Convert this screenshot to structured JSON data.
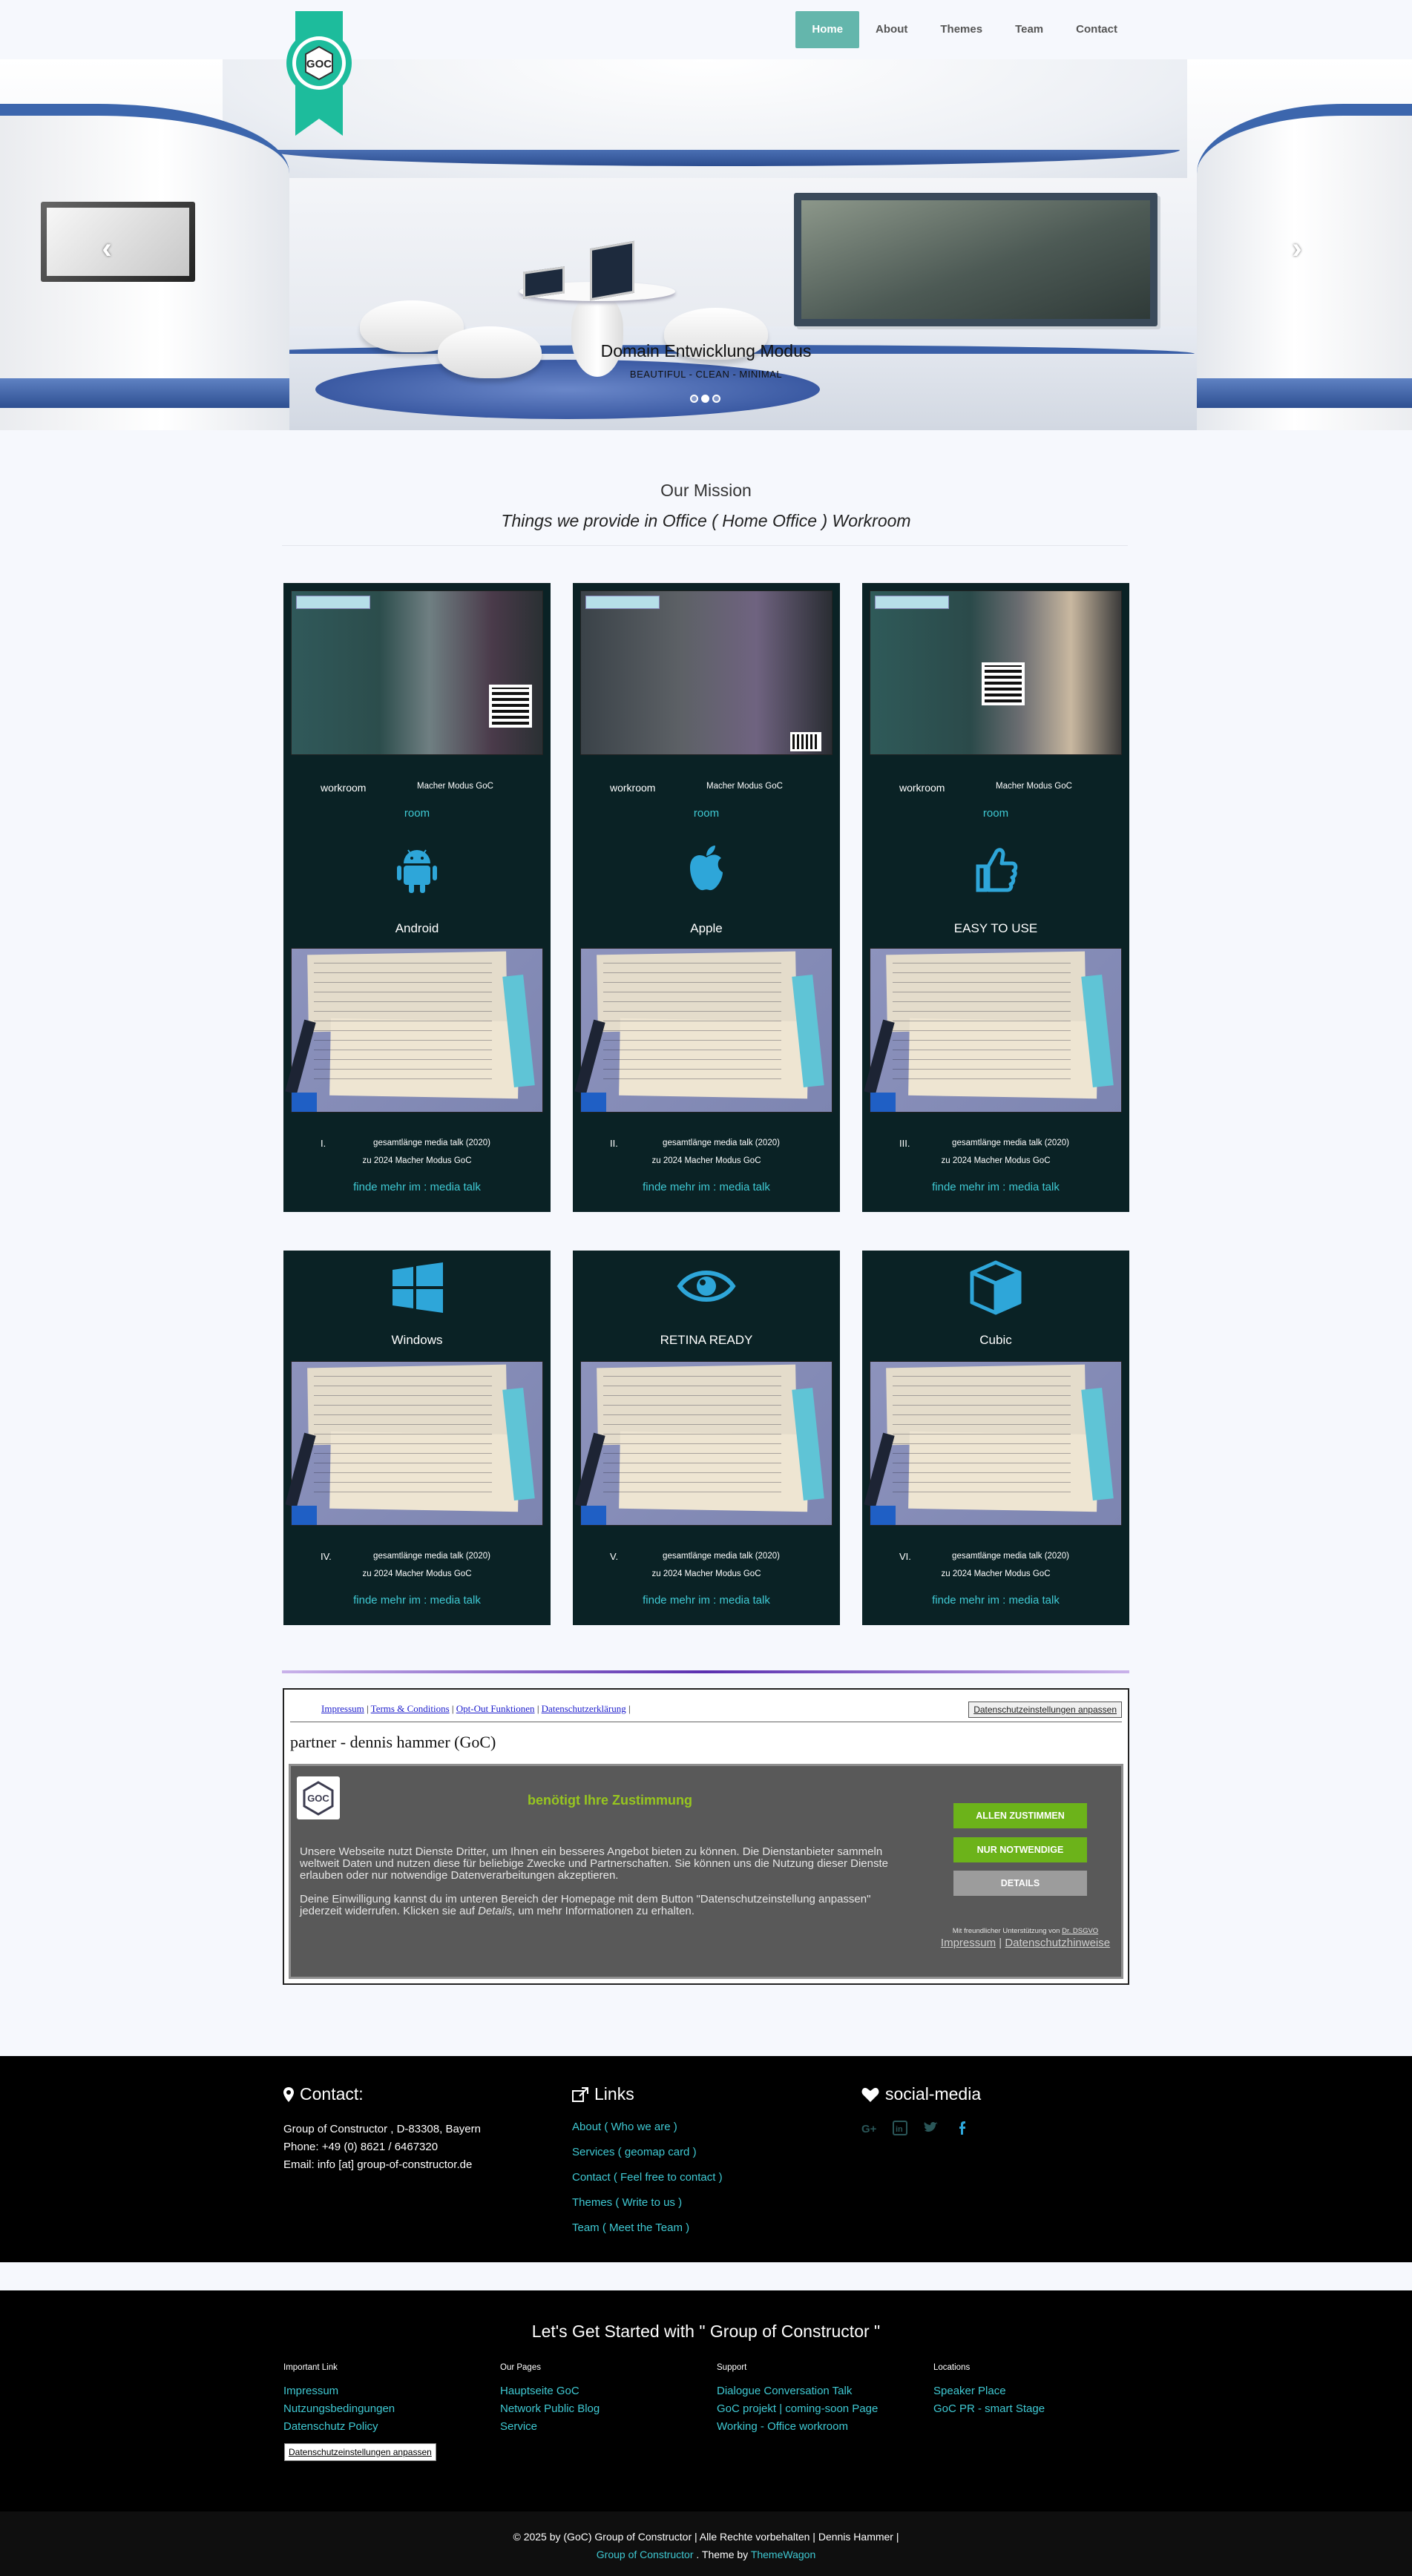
{
  "nav": {
    "items": [
      {
        "label": "Home"
      },
      {
        "label": "About"
      },
      {
        "label": "Themes"
      },
      {
        "label": "Team"
      },
      {
        "label": "Contact"
      }
    ],
    "logo_text": "GOC"
  },
  "hero": {
    "title": "Domain Entwicklung Modus",
    "subtitle": "BEAUTIFUL - CLEAN - MINIMAL",
    "prev_icon": "chevron-left-icon",
    "next_icon": "chevron-right-icon"
  },
  "mission": {
    "title": "Our Mission",
    "subtitle": "Things we provide in Office ( Home Office ) Workroom"
  },
  "cards_row1": [
    {
      "room_left": "workroom",
      "room_right": "Macher Modus GoC",
      "room_link": "room",
      "icon": "android-icon",
      "title": "Android",
      "roman": "I.",
      "meta1": "gesamtlänge media talk (2020)",
      "meta2": "zu 2024 Macher Modus GoC",
      "link": "finde mehr im : media talk"
    },
    {
      "room_left": "workroom",
      "room_right": "Macher Modus GoC",
      "room_link": "room",
      "icon": "apple-icon",
      "title": "Apple",
      "roman": "II.",
      "meta1": "gesamtlänge media talk (2020)",
      "meta2": "zu 2024 Macher Modus GoC",
      "link": "finde mehr im : media talk"
    },
    {
      "room_left": "workroom",
      "room_right": "Macher Modus GoC",
      "room_link": "room",
      "icon": "thumbs-up-icon",
      "title": "EASY TO USE",
      "roman": "III.",
      "meta1": "gesamtlänge media talk (2020)",
      "meta2": "zu 2024 Macher Modus GoC",
      "link": "finde mehr im : media talk"
    }
  ],
  "cards_row2": [
    {
      "icon": "windows-icon",
      "title": "Windows",
      "roman": "IV.",
      "meta1": "gesamtlänge media talk (2020)",
      "meta2": "zu 2024 Macher Modus GoC",
      "link": "finde mehr im : media talk"
    },
    {
      "icon": "eye-icon",
      "title": "RETINA READY",
      "roman": "V.",
      "meta1": "gesamtlänge media talk (2020)",
      "meta2": "zu 2024 Macher Modus GoC",
      "link": "finde mehr im : media talk"
    },
    {
      "icon": "cube-icon",
      "title": "Cubic",
      "roman": "VI.",
      "meta1": "gesamtlänge media talk (2020)",
      "meta2": "zu 2024 Macher Modus GoC",
      "link": "finde mehr im : media talk"
    }
  ],
  "consent": {
    "links": [
      "Impressum",
      "Terms & Conditions",
      "Opt-Out Funktionen",
      "Datenschutzerklärung"
    ],
    "settings_button": "Datenschutzeinstellungen anpassen",
    "partner": "partner - dennis hammer (GoC)",
    "heading": "benötigt Ihre Zustimmung",
    "para1": "Unsere Webseite nutzt Dienste Dritter, um Ihnen ein besseres Angebot bieten zu können. Die Dienstanbieter sammeln weltweit Daten und nutzen diese für beliebige Zwecke und Partnerschaften. Sie können uns die Nutzung dieser Dienste erlauben oder nur notwendige Datenverarbeitungen akzeptieren.",
    "para2_a": "Deine Einwilligung kannst du im unteren Bereich der Homepage mit dem Button \"Datenschutzeinstellung anpassen\" jederzeit widerrufen. Klicken sie auf ",
    "para2_em": "Details",
    "para2_b": ", um mehr Informationen zu erhalten.",
    "accept_all": "ALLEN ZUSTIMMEN",
    "only_necessary": "NUR NOTWENDIGE",
    "details": "DETAILS",
    "support_text": "Mit freundlicher Unterstützung von ",
    "support_link": "Dr. DSGVO",
    "footer_impressum": "Impressum",
    "footer_privacy": "Datenschutzhinweise"
  },
  "footer_contact": {
    "title": "Contact:",
    "address": "Group of Constructor , D-83308, Bayern",
    "phone": "Phone: +49 (0) 8621 / 6467320",
    "email": "Email: info [at] group-of-constructor.de"
  },
  "footer_links": {
    "title": "Links",
    "items": [
      "About ( Who we are )",
      "Services ( geomap card )",
      "Contact ( Feel free to contact )",
      "Themes ( Write to us )",
      "Team ( Meet the Team )"
    ]
  },
  "footer_social": {
    "title": "social-media",
    "icons": [
      "google-plus-icon",
      "linkedin-icon",
      "twitter-icon",
      "facebook-icon"
    ]
  },
  "footer2": {
    "title": "Let's Get Started with \" Group of Constructor \"",
    "columns": [
      {
        "header": "Important Link",
        "links": [
          "Impressum",
          "Nutzungsbedingungen",
          "Datenschutz Policy"
        ]
      },
      {
        "header": "Our Pages",
        "links": [
          "Hauptseite GoC",
          "Network Public Blog",
          "Service"
        ]
      },
      {
        "header": "Support",
        "links": [
          "Dialogue Conversation Talk",
          "GoC projekt | coming-soon Page",
          "Working - Office workroom"
        ]
      },
      {
        "header": "Locations",
        "links": [
          "Speaker Place",
          "GoC PR - smart Stage"
        ]
      }
    ],
    "settings_button": "Datenschutzeinstellungen anpassen"
  },
  "footer3": {
    "copyright": "© 2025 by (GoC) Group of Constructor | Alle Rechte vorbehalten | Dennis Hammer |",
    "brand_link": "Group of Constructor",
    "theme_by": " . Theme by ",
    "theme_link": "ThemeWagon"
  }
}
